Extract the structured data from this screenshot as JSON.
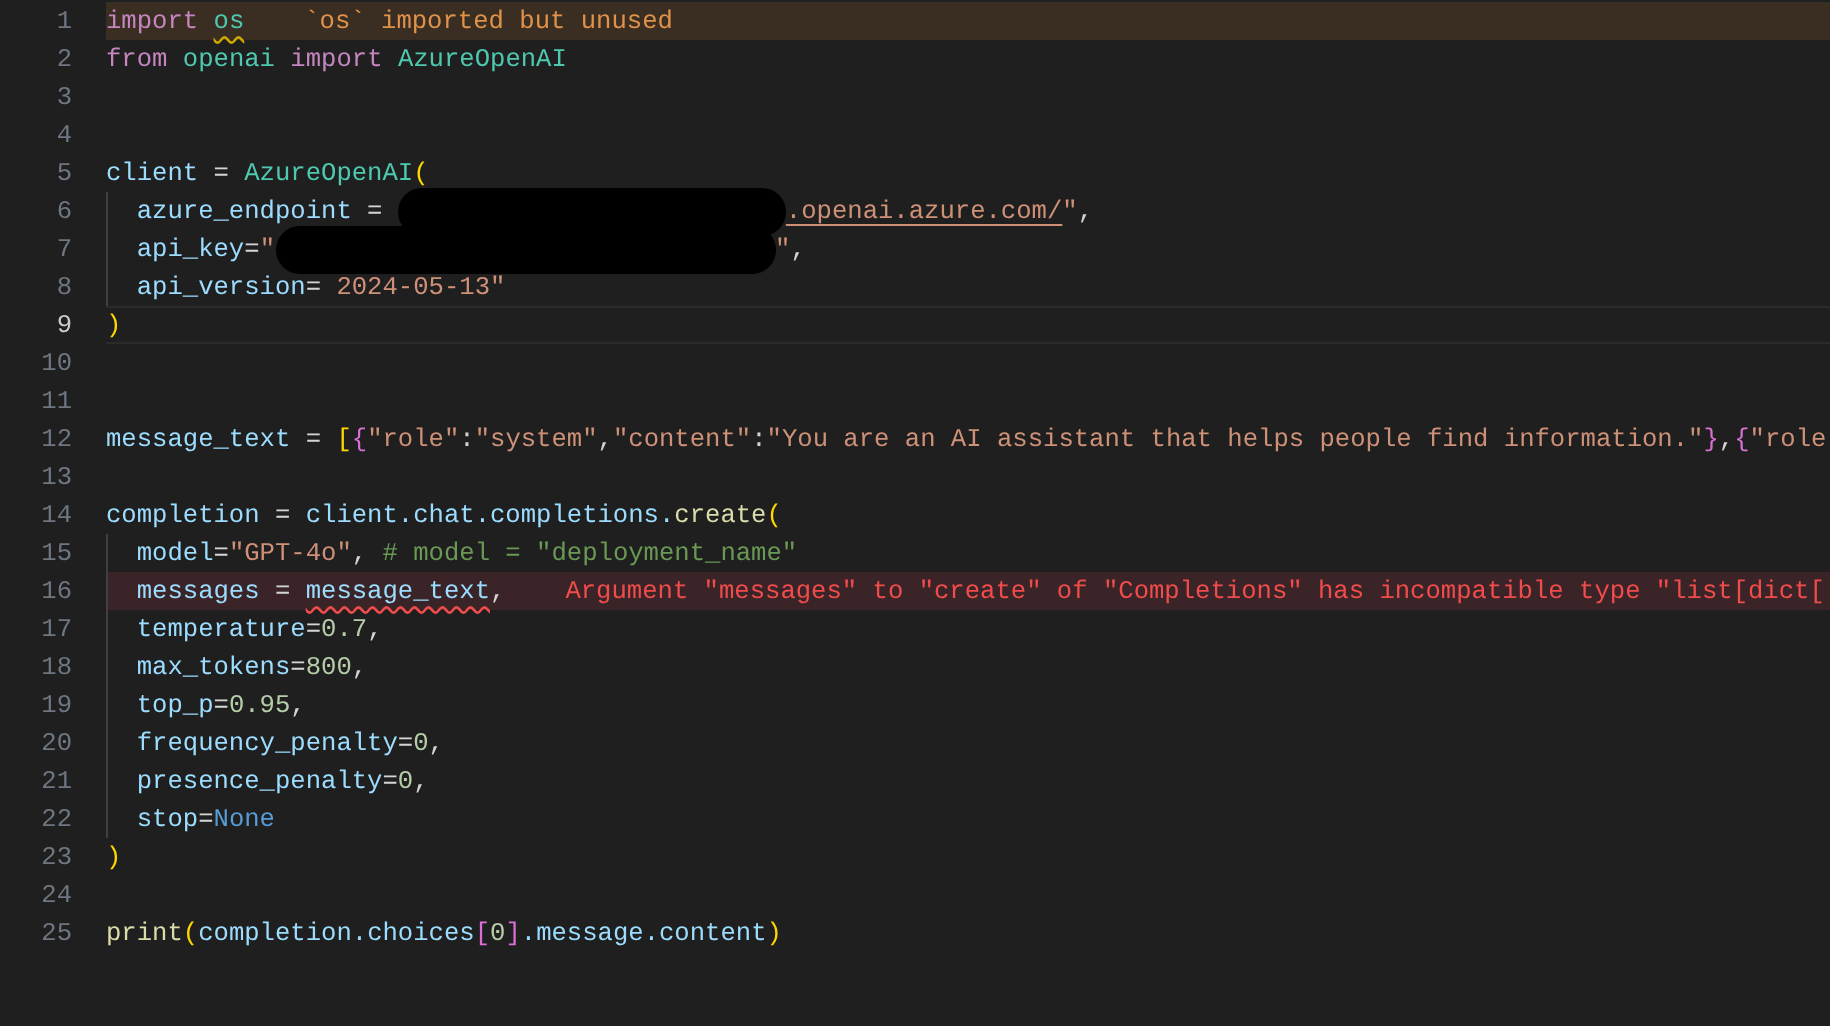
{
  "editor": {
    "lines": [
      {
        "number": "1",
        "kind": "warning",
        "current": false,
        "indent_guide": false,
        "segments": [
          {
            "kind": "code",
            "tokens": [
              {
                "text": "import ",
                "kind": "keyword"
              },
              {
                "text": "os",
                "kind": "module",
                "squiggly": true
              }
            ]
          },
          {
            "kind": "diagnostic",
            "text": "`os` imported but unused"
          }
        ]
      },
      {
        "number": "2",
        "kind": "normal",
        "current": false,
        "indent_guide": false,
        "segments": [
          {
            "kind": "code",
            "tokens": [
              {
                "text": "from ",
                "kind": "keyword"
              },
              {
                "text": "openai ",
                "kind": "module"
              },
              {
                "text": "import ",
                "kind": "keyword"
              },
              {
                "text": "AzureOpenAI",
                "kind": "module"
              }
            ]
          }
        ]
      },
      {
        "number": "3",
        "kind": "normal",
        "current": false,
        "indent_guide": false
      },
      {
        "number": "4",
        "kind": "normal",
        "current": false,
        "indent_guide": false
      },
      {
        "number": "5",
        "kind": "normal",
        "current": false,
        "indent_guide": false,
        "segments": [
          {
            "kind": "code",
            "tokens": [
              {
                "text": "client",
                "kind": "variable"
              },
              {
                "text": " = ",
                "kind": "plain"
              },
              {
                "text": "AzureOpenAI",
                "kind": "module"
              },
              {
                "text": "(",
                "kind": "paren"
              }
            ]
          }
        ]
      },
      {
        "number": "6",
        "kind": "normal",
        "current": false,
        "indent_guide": true,
        "segments": [
          {
            "kind": "code",
            "tokens": [
              {
                "text": "  azure_endpoint",
                "kind": "variable"
              },
              {
                "text": " = ",
                "kind": "plain"
              }
            ]
          },
          {
            "kind": "redaction"
          },
          {
            "kind": "code",
            "tokens": [
              {
                "text": ".openai.azure.com/",
                "kind": "string",
                "link": true
              },
              {
                "text": "\"",
                "kind": "string"
              },
              {
                "text": ",",
                "kind": "plain"
              }
            ]
          }
        ]
      },
      {
        "number": "7",
        "kind": "normal",
        "current": false,
        "indent_guide": true,
        "segments": [
          {
            "kind": "code",
            "tokens": [
              {
                "text": "  api_key",
                "kind": "variable"
              },
              {
                "text": "=",
                "kind": "plain"
              },
              {
                "text": "\"",
                "kind": "string"
              }
            ]
          },
          {
            "kind": "redaction"
          },
          {
            "kind": "code",
            "tokens": [
              {
                "text": "\"",
                "kind": "string"
              },
              {
                "text": ",",
                "kind": "plain"
              }
            ]
          }
        ]
      },
      {
        "number": "8",
        "kind": "normal",
        "current": false,
        "indent_guide": true,
        "segments": [
          {
            "kind": "code",
            "tokens": [
              {
                "text": "  api_version",
                "kind": "variable"
              },
              {
                "text": "= ",
                "kind": "plain"
              },
              {
                "text": "2024-05-13\"",
                "kind": "string"
              }
            ]
          }
        ]
      },
      {
        "number": "9",
        "kind": "normal",
        "current": true,
        "indent_guide": false,
        "segments": [
          {
            "kind": "code",
            "tokens": [
              {
                "text": ")",
                "kind": "paren"
              }
            ]
          }
        ]
      },
      {
        "number": "10",
        "kind": "normal",
        "current": false,
        "indent_guide": false
      },
      {
        "number": "11",
        "kind": "normal",
        "current": false,
        "indent_guide": false
      },
      {
        "number": "12",
        "kind": "normal",
        "current": false,
        "indent_guide": false,
        "segments": [
          {
            "kind": "code",
            "tokens": [
              {
                "text": "message_text",
                "kind": "variable"
              },
              {
                "text": " = ",
                "kind": "plain"
              },
              {
                "text": "[",
                "kind": "paren"
              },
              {
                "text": "{",
                "kind": "brace"
              },
              {
                "text": "\"role\"",
                "kind": "string"
              },
              {
                "text": ":",
                "kind": "plain"
              },
              {
                "text": "\"system\"",
                "kind": "string"
              },
              {
                "text": ",",
                "kind": "plain"
              },
              {
                "text": "\"content\"",
                "kind": "string"
              },
              {
                "text": ":",
                "kind": "plain"
              },
              {
                "text": "\"You are an AI assistant that helps people find information.\"",
                "kind": "string"
              },
              {
                "text": "}",
                "kind": "brace"
              },
              {
                "text": ",",
                "kind": "plain"
              },
              {
                "text": "{",
                "kind": "brace"
              },
              {
                "text": "\"role",
                "kind": "string"
              }
            ]
          }
        ]
      },
      {
        "number": "13",
        "kind": "normal",
        "current": false,
        "indent_guide": false
      },
      {
        "number": "14",
        "kind": "normal",
        "current": false,
        "indent_guide": false,
        "segments": [
          {
            "kind": "code",
            "tokens": [
              {
                "text": "completion",
                "kind": "variable"
              },
              {
                "text": " = ",
                "kind": "plain"
              },
              {
                "text": "client.chat.completions.",
                "kind": "variable"
              },
              {
                "text": "create",
                "kind": "function"
              },
              {
                "text": "(",
                "kind": "paren"
              }
            ]
          }
        ]
      },
      {
        "number": "15",
        "kind": "normal",
        "current": false,
        "indent_guide": true,
        "segments": [
          {
            "kind": "code",
            "tokens": [
              {
                "text": "  model",
                "kind": "variable"
              },
              {
                "text": "=",
                "kind": "plain"
              },
              {
                "text": "\"GPT-4o\"",
                "kind": "string"
              },
              {
                "text": ", ",
                "kind": "plain"
              },
              {
                "text": "# model = \"deployment_name\"",
                "kind": "comment"
              }
            ]
          }
        ]
      },
      {
        "number": "16",
        "kind": "error",
        "current": false,
        "indent_guide": true,
        "segments": [
          {
            "kind": "code",
            "tokens": [
              {
                "text": "  messages",
                "kind": "variable"
              },
              {
                "text": " = ",
                "kind": "plain"
              },
              {
                "text": "message_text",
                "kind": "variable",
                "squiggly": true
              },
              {
                "text": ",",
                "kind": "plain"
              }
            ]
          },
          {
            "kind": "diagnostic",
            "text": "Argument \"messages\" to \"create\" of \"Completions\" has incompatible type \"list[dict["
          }
        ]
      },
      {
        "number": "17",
        "kind": "normal",
        "current": false,
        "indent_guide": true,
        "segments": [
          {
            "kind": "code",
            "tokens": [
              {
                "text": "  temperature",
                "kind": "variable"
              },
              {
                "text": "=",
                "kind": "plain"
              },
              {
                "text": "0.7",
                "kind": "number"
              },
              {
                "text": ",",
                "kind": "plain"
              }
            ]
          }
        ]
      },
      {
        "number": "18",
        "kind": "normal",
        "current": false,
        "indent_guide": true,
        "segments": [
          {
            "kind": "code",
            "tokens": [
              {
                "text": "  max_tokens",
                "kind": "variable"
              },
              {
                "text": "=",
                "kind": "plain"
              },
              {
                "text": "800",
                "kind": "number"
              },
              {
                "text": ",",
                "kind": "plain"
              }
            ]
          }
        ]
      },
      {
        "number": "19",
        "kind": "normal",
        "current": false,
        "indent_guide": true,
        "segments": [
          {
            "kind": "code",
            "tokens": [
              {
                "text": "  top_p",
                "kind": "variable"
              },
              {
                "text": "=",
                "kind": "plain"
              },
              {
                "text": "0.95",
                "kind": "number"
              },
              {
                "text": ",",
                "kind": "plain"
              }
            ]
          }
        ]
      },
      {
        "number": "20",
        "kind": "normal",
        "current": false,
        "indent_guide": true,
        "segments": [
          {
            "kind": "code",
            "tokens": [
              {
                "text": "  frequency_penalty",
                "kind": "variable"
              },
              {
                "text": "=",
                "kind": "plain"
              },
              {
                "text": "0",
                "kind": "number"
              },
              {
                "text": ",",
                "kind": "plain"
              }
            ]
          }
        ]
      },
      {
        "number": "21",
        "kind": "normal",
        "current": false,
        "indent_guide": true,
        "segments": [
          {
            "kind": "code",
            "tokens": [
              {
                "text": "  presence_penalty",
                "kind": "variable"
              },
              {
                "text": "=",
                "kind": "plain"
              },
              {
                "text": "0",
                "kind": "number"
              },
              {
                "text": ",",
                "kind": "plain"
              }
            ]
          }
        ]
      },
      {
        "number": "22",
        "kind": "normal",
        "current": false,
        "indent_guide": true,
        "segments": [
          {
            "kind": "code",
            "tokens": [
              {
                "text": "  stop",
                "kind": "variable"
              },
              {
                "text": "=",
                "kind": "plain"
              },
              {
                "text": "None",
                "kind": "constant"
              }
            ]
          }
        ]
      },
      {
        "number": "23",
        "kind": "normal",
        "current": false,
        "indent_guide": false,
        "segments": [
          {
            "kind": "code",
            "tokens": [
              {
                "text": ")",
                "kind": "paren"
              }
            ]
          }
        ]
      },
      {
        "number": "24",
        "kind": "normal",
        "current": false,
        "indent_guide": false
      },
      {
        "number": "25",
        "kind": "normal",
        "current": false,
        "indent_guide": false,
        "segments": [
          {
            "kind": "code",
            "tokens": [
              {
                "text": "print",
                "kind": "function"
              },
              {
                "text": "(",
                "kind": "paren"
              },
              {
                "text": "completion.choices",
                "kind": "variable"
              },
              {
                "text": "[",
                "kind": "brace"
              },
              {
                "text": "0",
                "kind": "number"
              },
              {
                "text": "]",
                "kind": "brace"
              },
              {
                "text": ".message.content",
                "kind": "variable"
              },
              {
                "text": ")",
                "kind": "paren"
              }
            ]
          }
        ]
      }
    ]
  }
}
